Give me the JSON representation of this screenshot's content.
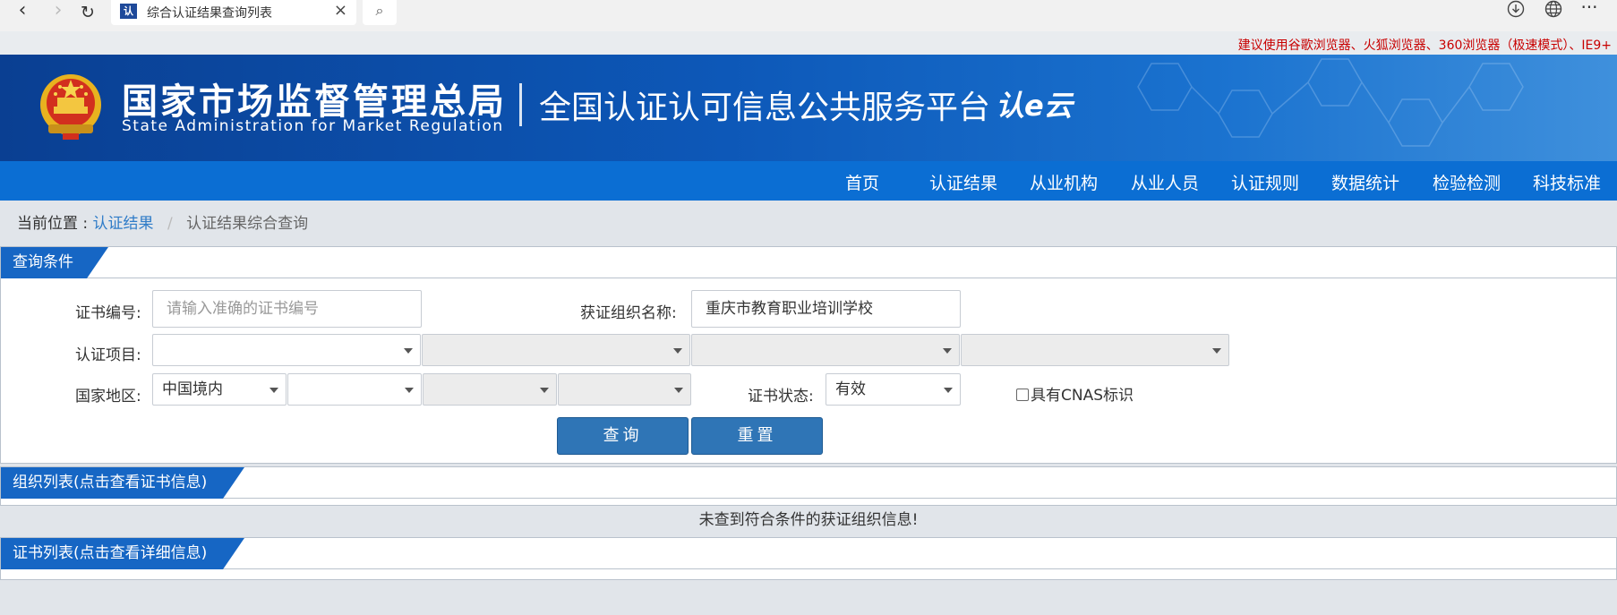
{
  "browser": {
    "tab_title": "综合认证结果查询列表",
    "tab_favicon": "认",
    "icons": [
      "back-icon",
      "forward-icon",
      "refresh-icon",
      "close-icon",
      "search-icon",
      "download-icon",
      "globe-icon",
      "more-icon"
    ]
  },
  "notice": "建议使用谷歌浏览器、火狐浏览器、360浏览器（极速模式）、IE9+",
  "header": {
    "agency_cn": "国家市场监督管理总局",
    "agency_en": "State Administration  for  Market Regulation",
    "platform": "全国认证认可信息公共服务平台",
    "brand_logo": "认e云"
  },
  "nav": [
    "首页",
    "认证结果",
    "从业机构",
    "从业人员",
    "认证规则",
    "数据统计",
    "检验检测",
    "科技标准"
  ],
  "breadcrumb": {
    "label": "当前位置 :",
    "link": "认证结果",
    "separator": "/",
    "current": "认证结果综合查询"
  },
  "query": {
    "title": "查询条件",
    "cert_no_label": "证书编号:",
    "cert_no_placeholder": "请输入准确的证书编号",
    "cert_no_value": "",
    "org_name_label": "获证组织名称:",
    "org_name_value": "重庆市教育职业培训学校",
    "project_label": "认证项目:",
    "region_label": "国家地区:",
    "region_value": "中国境内",
    "status_label": "证书状态:",
    "status_value": "有效",
    "cnas_label": "具有CNAS标识",
    "search_button": "查询",
    "reset_button": "重置"
  },
  "org_list": {
    "title": "组织列表(点击查看证书信息)",
    "empty_message": "未查到符合条件的获证组织信息!"
  },
  "cert_list": {
    "title": "证书列表(点击查看详细信息)"
  },
  "colors": {
    "nav_blue": "#0b6ed3",
    "panel_tab_blue": "#1666c4",
    "button_blue": "#2f75b6",
    "notice_red": "#c80000",
    "link_blue": "#2f7cc8"
  }
}
